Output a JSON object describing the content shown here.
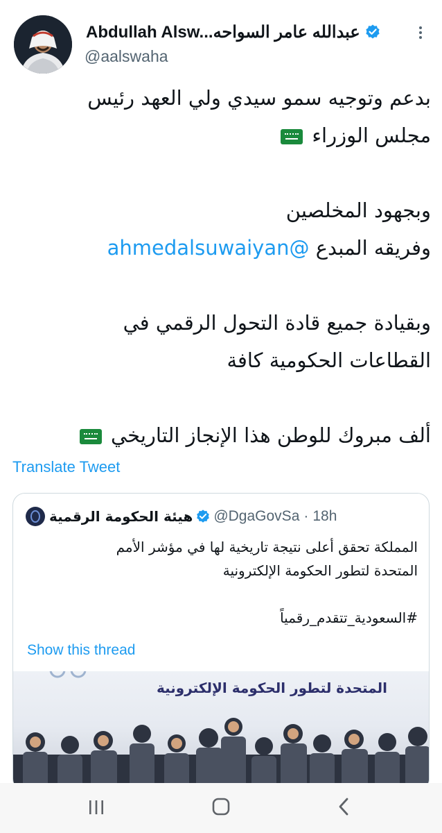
{
  "tweet": {
    "author_name": "Abdullah Alsw...عبدالله عامر السواحه",
    "author_handle": "@aalswaha",
    "body": {
      "line1": "بدعم وتوجيه سمو سيدي ولي العهد رئيس",
      "line2": "مجلس الوزراء",
      "line3": "وبجهود المخلصين",
      "line4_mention": "@ahmedalsuwaiyan",
      "line4_text": "وفريقه المبدع",
      "line5": "وبقيادة جميع قادة التحول الرقمي في",
      "line6": "القطاعات  الحكومية كافة",
      "line7": "ألف مبروك للوطن هذا الإنجاز التاريخي"
    },
    "translate_label": "Translate Tweet"
  },
  "quoted_tweet": {
    "author_name": "هيئة الحكومة الرقمية",
    "author_handle": "@DgaGovSa",
    "separator": "·",
    "time": "18h",
    "text_line1": "المملكة تحقق أعلى نتيجة تاريخية لها في مؤشر الأمم",
    "text_line2": "المتحدة لتطور الحكومة الإلكترونية",
    "hashtag": "#السعودية_تتقدم_رقمياً",
    "show_thread_label": "Show this thread",
    "image_caption": "المتحدة لتطور الحكومة الإلكترونية"
  },
  "colors": {
    "accent": "#1d9bf0",
    "secondary_text": "#536471",
    "border": "#cfd9de",
    "flag_green": "#1a8a3c"
  },
  "icons": {
    "more": "more-vertical-icon",
    "verified": "verified-badge-icon",
    "flag": "saudi-flag-emoji",
    "nav": [
      "recent-apps-icon",
      "home-icon",
      "back-icon"
    ]
  }
}
